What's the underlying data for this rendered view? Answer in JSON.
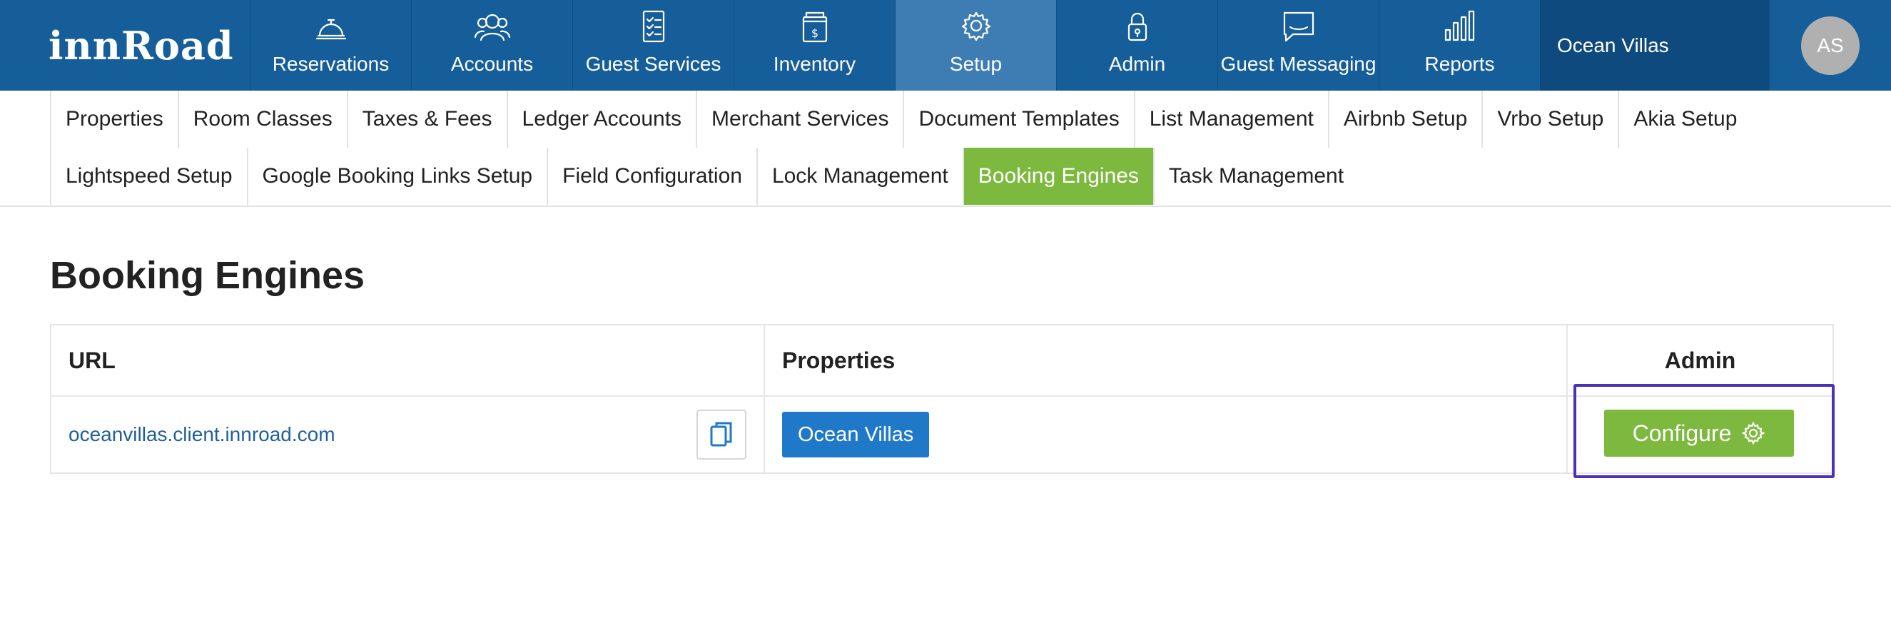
{
  "brand": {
    "logo_text": "innRoad",
    "primary_color": "#165e99",
    "active_color": "#3e7db3",
    "accent_green": "#7cb93e"
  },
  "nav": {
    "items": [
      {
        "label": "Reservations",
        "icon": "bell-icon"
      },
      {
        "label": "Accounts",
        "icon": "users-icon"
      },
      {
        "label": "Guest Services",
        "icon": "checklist-icon"
      },
      {
        "label": "Inventory",
        "icon": "price-tag-icon"
      },
      {
        "label": "Setup",
        "icon": "gear-icon",
        "active": true
      },
      {
        "label": "Admin",
        "icon": "lock-icon"
      },
      {
        "label": "Guest Messaging",
        "icon": "message-icon"
      },
      {
        "label": "Reports",
        "icon": "bar-chart-icon"
      }
    ],
    "property_name": "Ocean Villas",
    "avatar_initials": "AS"
  },
  "subnav": {
    "row1": [
      "Properties",
      "Room Classes",
      "Taxes & Fees",
      "Ledger Accounts",
      "Merchant Services",
      "Document Templates",
      "List Management",
      "Airbnb Setup",
      "Vrbo Setup",
      "Akia Setup"
    ],
    "row2": [
      "Lightspeed Setup",
      "Google Booking Links Setup",
      "Field Configuration",
      "Lock Management",
      "Booking Engines",
      "Task Management"
    ],
    "active": "Booking Engines"
  },
  "page": {
    "title": "Booking Engines"
  },
  "table": {
    "headers": {
      "url": "URL",
      "properties": "Properties",
      "admin": "Admin"
    },
    "rows": [
      {
        "url": "oceanvillas.client.innroad.com",
        "property": "Ocean Villas",
        "action": "Configure"
      }
    ]
  }
}
